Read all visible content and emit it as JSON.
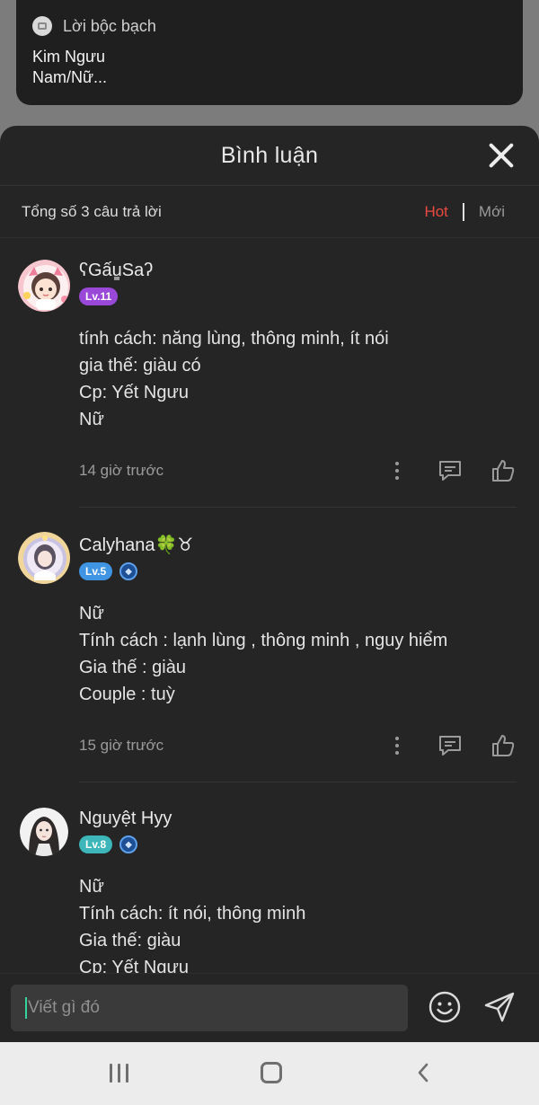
{
  "top_card": {
    "icon": "document-icon",
    "title": "Lời bộc bạch",
    "lines": [
      "Kim Ngưu",
      "Nam/Nữ..."
    ]
  },
  "sheet": {
    "title": "Bình luận",
    "close_icon": "close-icon",
    "total_label": "Tổng số 3 câu trả lời",
    "sort": {
      "hot": "Hot",
      "new": "Mới",
      "active": "hot",
      "hot_color": "#ea4a3f"
    }
  },
  "comments": [
    {
      "username": "ʕGấu̳Saʔ",
      "level": "Lv.11",
      "level_color": "#9a48d8",
      "verified": false,
      "body": [
        "tính cách: năng lùng, thông minh, ít nói",
        "gia thế: giàu có",
        "Cp: Yết Ngưu",
        "Nữ"
      ],
      "time": "14 giờ trước"
    },
    {
      "username": "Calyhana🍀♉",
      "level": "Lv.5",
      "level_color": "#3f94e3",
      "verified": true,
      "body": [
        "Nữ",
        "Tính cách : lạnh lùng , thông minh , nguy hiểm",
        "Gia thế : giàu",
        "Couple : tuỳ"
      ],
      "time": "15 giờ trước"
    },
    {
      "username": "Nguyệt Hyy",
      "level": "Lv.8",
      "level_color": "#3cb6b8",
      "verified": true,
      "body": [
        "Nữ",
        "Tính cách: ít nói, thông minh",
        "Gia thế: giàu",
        "Cp: Yết Ngưu"
      ],
      "time": ""
    }
  ],
  "composer": {
    "placeholder": "Viết gì đó",
    "emoji_icon": "emoji-icon",
    "send_icon": "send-icon"
  },
  "navbar": {
    "recent": "recent-apps-icon",
    "home": "home-icon",
    "back": "back-icon"
  }
}
